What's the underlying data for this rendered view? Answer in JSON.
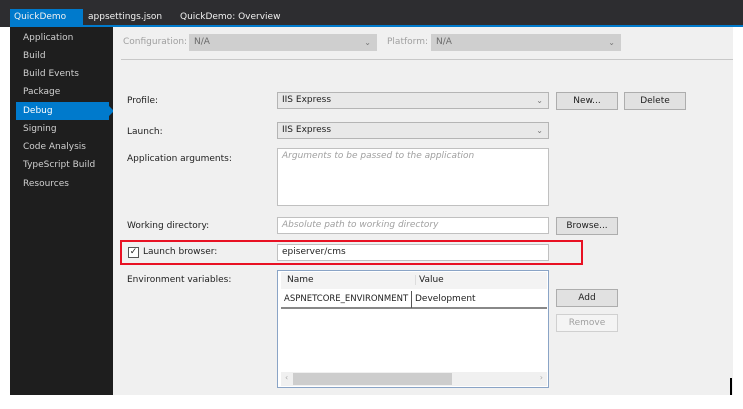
{
  "tabs": [
    {
      "label": "QuickDemo",
      "close": "✕"
    },
    {
      "label": "appsettings.json"
    },
    {
      "label": "QuickDemo: Overview"
    }
  ],
  "sidebar": {
    "items": [
      {
        "label": "Application"
      },
      {
        "label": "Build"
      },
      {
        "label": "Build Events"
      },
      {
        "label": "Package"
      },
      {
        "label": "Debug"
      },
      {
        "label": "Signing"
      },
      {
        "label": "Code Analysis"
      },
      {
        "label": "TypeScript Build"
      },
      {
        "label": "Resources"
      }
    ]
  },
  "config": {
    "configuration_label": "Configuration:",
    "configuration_value": "N/A",
    "platform_label": "Platform:",
    "platform_value": "N/A"
  },
  "form": {
    "profile_label": "Profile:",
    "profile_value": "IIS Express",
    "new_button": "New...",
    "delete_button": "Delete",
    "launch_label": "Launch:",
    "launch_value": "IIS Express",
    "args_label": "Application arguments:",
    "args_placeholder": "Arguments to be passed to the application",
    "workdir_label": "Working directory:",
    "workdir_placeholder": "Absolute path to working directory",
    "browse_button": "Browse...",
    "launch_browser_label": "Launch browser:",
    "launch_browser_checked": true,
    "launch_browser_value": "episerver/cms",
    "env_label": "Environment variables:",
    "env_columns": [
      "Name",
      "Value"
    ],
    "env_rows": [
      [
        "ASPNETCORE_ENVIRONMENT",
        "Development"
      ]
    ],
    "add_button": "Add",
    "remove_button": "Remove"
  },
  "colors": {
    "accent": "#007acc",
    "highlight": "#e81123"
  }
}
